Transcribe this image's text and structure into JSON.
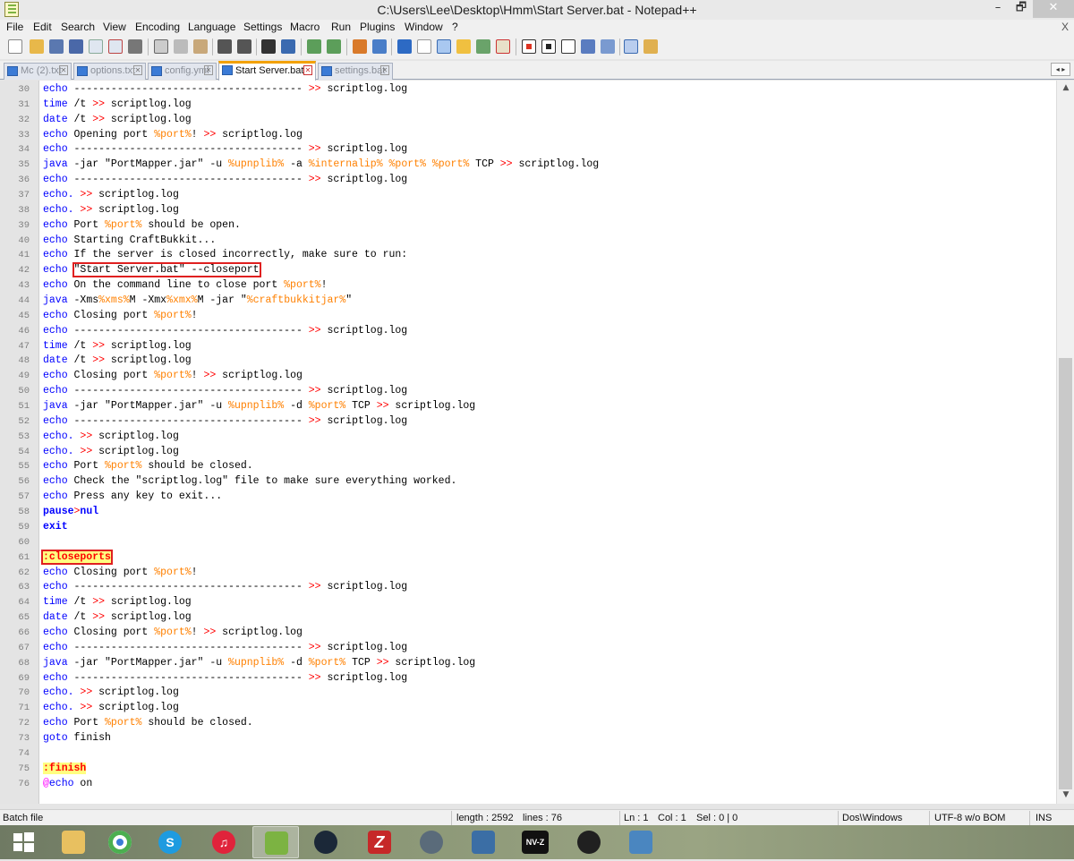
{
  "window": {
    "title": "C:\\Users\\Lee\\Desktop\\Hmm\\Start Server.bat - Notepad++",
    "min_glyph": "–",
    "max_glyph": "🗗",
    "close_glyph": "✕"
  },
  "menu": {
    "items": [
      "File",
      "Edit",
      "Search",
      "View",
      "Encoding",
      "Language",
      "Settings",
      "Macro",
      "Run",
      "Plugins",
      "Window",
      "?"
    ],
    "close_doc": "X"
  },
  "tabs": [
    {
      "label": "Mc (2).txt",
      "close": "✕"
    },
    {
      "label": "options.txt",
      "close": "✕"
    },
    {
      "label": "config.yml",
      "close": "✕"
    },
    {
      "label": "Start Server.bat",
      "close": "✕"
    },
    {
      "label": "settings.bat",
      "close": "✕"
    }
  ],
  "tab_scroll": "◂ ▸",
  "editor": {
    "lines": [
      {
        "n": "30",
        "segs": [
          {
            "t": "echo",
            "c": "kw"
          },
          {
            "t": " ------------------------------------- ",
            "c": ""
          },
          {
            "t": ">>",
            "c": "op"
          },
          {
            "t": " scriptlog.log",
            "c": ""
          }
        ]
      },
      {
        "n": "31",
        "segs": [
          {
            "t": "time",
            "c": "kw"
          },
          {
            "t": " /t ",
            "c": ""
          },
          {
            "t": ">>",
            "c": "op"
          },
          {
            "t": " scriptlog.log",
            "c": ""
          }
        ]
      },
      {
        "n": "32",
        "segs": [
          {
            "t": "date",
            "c": "kw"
          },
          {
            "t": " /t ",
            "c": ""
          },
          {
            "t": ">>",
            "c": "op"
          },
          {
            "t": " scriptlog.log",
            "c": ""
          }
        ]
      },
      {
        "n": "33",
        "segs": [
          {
            "t": "echo",
            "c": "kw"
          },
          {
            "t": " Opening port ",
            "c": ""
          },
          {
            "t": "%port%",
            "c": "var"
          },
          {
            "t": "! ",
            "c": ""
          },
          {
            "t": ">>",
            "c": "op"
          },
          {
            "t": " scriptlog.log",
            "c": ""
          }
        ]
      },
      {
        "n": "34",
        "segs": [
          {
            "t": "echo",
            "c": "kw"
          },
          {
            "t": " ------------------------------------- ",
            "c": ""
          },
          {
            "t": ">>",
            "c": "op"
          },
          {
            "t": " scriptlog.log",
            "c": ""
          }
        ]
      },
      {
        "n": "35",
        "segs": [
          {
            "t": "java",
            "c": "java"
          },
          {
            "t": " -jar \"PortMapper.jar\" -u ",
            "c": ""
          },
          {
            "t": "%upnplib%",
            "c": "var"
          },
          {
            "t": " -a ",
            "c": ""
          },
          {
            "t": "%internalip%",
            "c": "var"
          },
          {
            "t": " ",
            "c": ""
          },
          {
            "t": "%port%",
            "c": "var"
          },
          {
            "t": " ",
            "c": ""
          },
          {
            "t": "%port%",
            "c": "var"
          },
          {
            "t": " TCP ",
            "c": ""
          },
          {
            "t": ">>",
            "c": "op"
          },
          {
            "t": " scriptlog.log",
            "c": ""
          }
        ]
      },
      {
        "n": "36",
        "segs": [
          {
            "t": "echo",
            "c": "kw"
          },
          {
            "t": " ------------------------------------- ",
            "c": ""
          },
          {
            "t": ">>",
            "c": "op"
          },
          {
            "t": " scriptlog.log",
            "c": ""
          }
        ]
      },
      {
        "n": "37",
        "segs": [
          {
            "t": "echo.",
            "c": "kw"
          },
          {
            "t": " ",
            "c": ""
          },
          {
            "t": ">>",
            "c": "op"
          },
          {
            "t": " scriptlog.log",
            "c": ""
          }
        ]
      },
      {
        "n": "38",
        "segs": [
          {
            "t": "echo.",
            "c": "kw"
          },
          {
            "t": " ",
            "c": ""
          },
          {
            "t": ">>",
            "c": "op"
          },
          {
            "t": " scriptlog.log",
            "c": ""
          }
        ]
      },
      {
        "n": "39",
        "segs": [
          {
            "t": "echo",
            "c": "kw"
          },
          {
            "t": " Port ",
            "c": ""
          },
          {
            "t": "%port%",
            "c": "var"
          },
          {
            "t": " should be open.",
            "c": ""
          }
        ]
      },
      {
        "n": "40",
        "segs": [
          {
            "t": "echo",
            "c": "kw"
          },
          {
            "t": " Starting CraftBukkit...",
            "c": ""
          }
        ]
      },
      {
        "n": "41",
        "segs": [
          {
            "t": "echo",
            "c": "kw"
          },
          {
            "t": " If the server is closed incorrectly, make sure to run:",
            "c": ""
          }
        ]
      },
      {
        "n": "42",
        "segs": [
          {
            "t": "echo",
            "c": "kw"
          },
          {
            "t": " ",
            "c": ""
          },
          {
            "t": "\"Start Server.bat\" --closeport",
            "c": "box"
          }
        ]
      },
      {
        "n": "43",
        "segs": [
          {
            "t": "echo",
            "c": "kw"
          },
          {
            "t": " On the command line to close port ",
            "c": ""
          },
          {
            "t": "%port%",
            "c": "var"
          },
          {
            "t": "!",
            "c": ""
          }
        ]
      },
      {
        "n": "44",
        "segs": [
          {
            "t": "java",
            "c": "java"
          },
          {
            "t": " -Xms",
            "c": ""
          },
          {
            "t": "%xms%",
            "c": "var"
          },
          {
            "t": "M -Xmx",
            "c": ""
          },
          {
            "t": "%xmx%",
            "c": "var"
          },
          {
            "t": "M -jar \"",
            "c": ""
          },
          {
            "t": "%craftbukkitjar%",
            "c": "var"
          },
          {
            "t": "\"",
            "c": ""
          }
        ]
      },
      {
        "n": "45",
        "segs": [
          {
            "t": "echo",
            "c": "kw"
          },
          {
            "t": " Closing port ",
            "c": ""
          },
          {
            "t": "%port%",
            "c": "var"
          },
          {
            "t": "!",
            "c": ""
          }
        ]
      },
      {
        "n": "46",
        "segs": [
          {
            "t": "echo",
            "c": "kw"
          },
          {
            "t": " ------------------------------------- ",
            "c": ""
          },
          {
            "t": ">>",
            "c": "op"
          },
          {
            "t": " scriptlog.log",
            "c": ""
          }
        ]
      },
      {
        "n": "47",
        "segs": [
          {
            "t": "time",
            "c": "kw"
          },
          {
            "t": " /t ",
            "c": ""
          },
          {
            "t": ">>",
            "c": "op"
          },
          {
            "t": " scriptlog.log",
            "c": ""
          }
        ]
      },
      {
        "n": "48",
        "segs": [
          {
            "t": "date",
            "c": "kw"
          },
          {
            "t": " /t ",
            "c": ""
          },
          {
            "t": ">>",
            "c": "op"
          },
          {
            "t": " scriptlog.log",
            "c": ""
          }
        ]
      },
      {
        "n": "49",
        "segs": [
          {
            "t": "echo",
            "c": "kw"
          },
          {
            "t": " Closing port ",
            "c": ""
          },
          {
            "t": "%port%",
            "c": "var"
          },
          {
            "t": "! ",
            "c": ""
          },
          {
            "t": ">>",
            "c": "op"
          },
          {
            "t": " scriptlog.log",
            "c": ""
          }
        ]
      },
      {
        "n": "50",
        "segs": [
          {
            "t": "echo",
            "c": "kw"
          },
          {
            "t": " ------------------------------------- ",
            "c": ""
          },
          {
            "t": ">>",
            "c": "op"
          },
          {
            "t": " scriptlog.log",
            "c": ""
          }
        ]
      },
      {
        "n": "51",
        "segs": [
          {
            "t": "java",
            "c": "java"
          },
          {
            "t": " -jar \"PortMapper.jar\" -u ",
            "c": ""
          },
          {
            "t": "%upnplib%",
            "c": "var"
          },
          {
            "t": " -d ",
            "c": ""
          },
          {
            "t": "%port%",
            "c": "var"
          },
          {
            "t": " TCP ",
            "c": ""
          },
          {
            "t": ">>",
            "c": "op"
          },
          {
            "t": " scriptlog.log",
            "c": ""
          }
        ]
      },
      {
        "n": "52",
        "segs": [
          {
            "t": "echo",
            "c": "kw"
          },
          {
            "t": " ------------------------------------- ",
            "c": ""
          },
          {
            "t": ">>",
            "c": "op"
          },
          {
            "t": " scriptlog.log",
            "c": ""
          }
        ]
      },
      {
        "n": "53",
        "segs": [
          {
            "t": "echo.",
            "c": "kw"
          },
          {
            "t": " ",
            "c": ""
          },
          {
            "t": ">>",
            "c": "op"
          },
          {
            "t": " scriptlog.log",
            "c": ""
          }
        ]
      },
      {
        "n": "54",
        "segs": [
          {
            "t": "echo.",
            "c": "kw"
          },
          {
            "t": " ",
            "c": ""
          },
          {
            "t": ">>",
            "c": "op"
          },
          {
            "t": " scriptlog.log",
            "c": ""
          }
        ]
      },
      {
        "n": "55",
        "segs": [
          {
            "t": "echo",
            "c": "kw"
          },
          {
            "t": " Port ",
            "c": ""
          },
          {
            "t": "%port%",
            "c": "var"
          },
          {
            "t": " should be closed.",
            "c": ""
          }
        ]
      },
      {
        "n": "56",
        "segs": [
          {
            "t": "echo",
            "c": "kw"
          },
          {
            "t": " Check the \"scriptlog.log\" file to make sure everything worked.",
            "c": ""
          }
        ]
      },
      {
        "n": "57",
        "segs": [
          {
            "t": "echo",
            "c": "kw"
          },
          {
            "t": " Press any key to exit...",
            "c": ""
          }
        ]
      },
      {
        "n": "58",
        "segs": [
          {
            "t": "pause",
            "c": "kw bold"
          },
          {
            "t": ">",
            "c": "op"
          },
          {
            "t": "nul",
            "c": "kw bold"
          }
        ]
      },
      {
        "n": "59",
        "segs": [
          {
            "t": "exit",
            "c": "kw bold"
          }
        ]
      },
      {
        "n": "60",
        "segs": []
      },
      {
        "n": "61",
        "segs": [
          {
            "t": ":closeports",
            "c": "lbl box"
          }
        ]
      },
      {
        "n": "62",
        "segs": [
          {
            "t": "echo",
            "c": "kw"
          },
          {
            "t": " Closing port ",
            "c": ""
          },
          {
            "t": "%port%",
            "c": "var"
          },
          {
            "t": "!",
            "c": ""
          }
        ]
      },
      {
        "n": "63",
        "segs": [
          {
            "t": "echo",
            "c": "kw"
          },
          {
            "t": " ------------------------------------- ",
            "c": ""
          },
          {
            "t": ">>",
            "c": "op"
          },
          {
            "t": " scriptlog.log",
            "c": ""
          }
        ]
      },
      {
        "n": "64",
        "segs": [
          {
            "t": "time",
            "c": "kw"
          },
          {
            "t": " /t ",
            "c": ""
          },
          {
            "t": ">>",
            "c": "op"
          },
          {
            "t": " scriptlog.log",
            "c": ""
          }
        ]
      },
      {
        "n": "65",
        "segs": [
          {
            "t": "date",
            "c": "kw"
          },
          {
            "t": " /t ",
            "c": ""
          },
          {
            "t": ">>",
            "c": "op"
          },
          {
            "t": " scriptlog.log",
            "c": ""
          }
        ]
      },
      {
        "n": "66",
        "segs": [
          {
            "t": "echo",
            "c": "kw"
          },
          {
            "t": " Closing port ",
            "c": ""
          },
          {
            "t": "%port%",
            "c": "var"
          },
          {
            "t": "! ",
            "c": ""
          },
          {
            "t": ">>",
            "c": "op"
          },
          {
            "t": " scriptlog.log",
            "c": ""
          }
        ]
      },
      {
        "n": "67",
        "segs": [
          {
            "t": "echo",
            "c": "kw"
          },
          {
            "t": " ------------------------------------- ",
            "c": ""
          },
          {
            "t": ">>",
            "c": "op"
          },
          {
            "t": " scriptlog.log",
            "c": ""
          }
        ]
      },
      {
        "n": "68",
        "segs": [
          {
            "t": "java",
            "c": "java"
          },
          {
            "t": " -jar \"PortMapper.jar\" -u ",
            "c": ""
          },
          {
            "t": "%upnplib%",
            "c": "var"
          },
          {
            "t": " -d ",
            "c": ""
          },
          {
            "t": "%port%",
            "c": "var"
          },
          {
            "t": " TCP ",
            "c": ""
          },
          {
            "t": ">>",
            "c": "op"
          },
          {
            "t": " scriptlog.log",
            "c": ""
          }
        ]
      },
      {
        "n": "69",
        "segs": [
          {
            "t": "echo",
            "c": "kw"
          },
          {
            "t": " ------------------------------------- ",
            "c": ""
          },
          {
            "t": ">>",
            "c": "op"
          },
          {
            "t": " scriptlog.log",
            "c": ""
          }
        ]
      },
      {
        "n": "70",
        "segs": [
          {
            "t": "echo.",
            "c": "kw"
          },
          {
            "t": " ",
            "c": ""
          },
          {
            "t": ">>",
            "c": "op"
          },
          {
            "t": " scriptlog.log",
            "c": ""
          }
        ]
      },
      {
        "n": "71",
        "segs": [
          {
            "t": "echo.",
            "c": "kw"
          },
          {
            "t": " ",
            "c": ""
          },
          {
            "t": ">>",
            "c": "op"
          },
          {
            "t": " scriptlog.log",
            "c": ""
          }
        ]
      },
      {
        "n": "72",
        "segs": [
          {
            "t": "echo",
            "c": "kw"
          },
          {
            "t": " Port ",
            "c": ""
          },
          {
            "t": "%port%",
            "c": "var"
          },
          {
            "t": " should be closed.",
            "c": ""
          }
        ]
      },
      {
        "n": "73",
        "segs": [
          {
            "t": "goto",
            "c": "kw"
          },
          {
            "t": " finish",
            "c": ""
          }
        ]
      },
      {
        "n": "74",
        "segs": []
      },
      {
        "n": "75",
        "segs": [
          {
            "t": ":finish",
            "c": "lbl"
          }
        ]
      },
      {
        "n": "76",
        "segs": [
          {
            "t": "@",
            "c": "at"
          },
          {
            "t": "echo",
            "c": "kw"
          },
          {
            "t": " on",
            "c": ""
          }
        ]
      }
    ]
  },
  "scrollbar": {
    "up": "▲",
    "down": "▼"
  },
  "status": {
    "filetype": "Batch file",
    "length": "length : 2592",
    "lines": "lines : 76",
    "ln": "Ln : 1",
    "col": "Col : 1",
    "sel": "Sel : 0 | 0",
    "eol": "Dos\\Windows",
    "encoding": "UTF-8 w/o BOM",
    "mode": "INS"
  },
  "taskbar": {
    "apps": [
      {
        "icon": "windows-start-icon",
        "label": ""
      },
      {
        "icon": "file-explorer-icon",
        "label": ""
      },
      {
        "icon": "chrome-icon",
        "label": ""
      },
      {
        "icon": "skype-icon",
        "label": "S"
      },
      {
        "icon": "itunes-icon",
        "label": "♫"
      },
      {
        "icon": "notepadpp-icon",
        "label": ""
      },
      {
        "icon": "steam-icon",
        "label": ""
      },
      {
        "icon": "filezilla-icon",
        "label": "Z"
      },
      {
        "icon": "app-icon",
        "label": ""
      },
      {
        "icon": "editor-icon",
        "label": ""
      },
      {
        "icon": "nvz-icon",
        "label": "NV-Z"
      },
      {
        "icon": "obs-icon",
        "label": ""
      },
      {
        "icon": "photos-icon",
        "label": ""
      }
    ]
  }
}
